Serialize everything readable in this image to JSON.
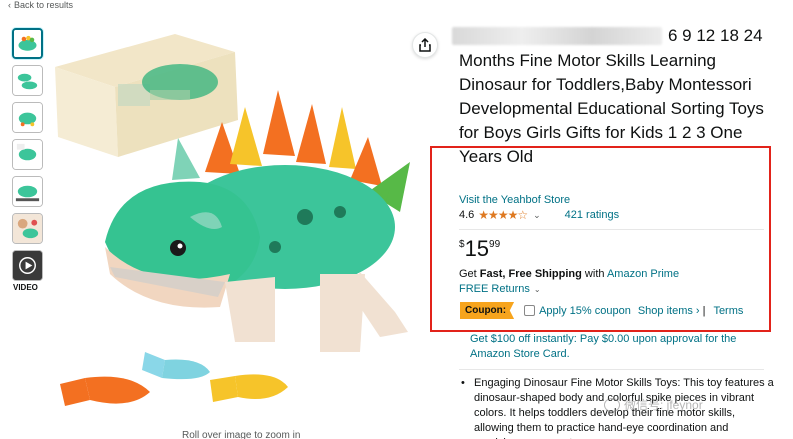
{
  "nav": {
    "back_label": "Back to results"
  },
  "gallery": {
    "video_label": "VIDEO",
    "rollover_hint": "Roll over image to zoom in",
    "main_image_icon": "green-dinosaur-toy-image",
    "blurred_box_icon": "blurred-product-box"
  },
  "product": {
    "title_top_visible": "6 9 12 18 24",
    "title": "Months Fine Motor Skills Learning Dinosaur for Toddlers,Baby Montessori Developmental Educational Sorting Toys for Boys Girls Gifts for Kids 1 2 3 One Years Old",
    "store_link": "Visit the Yeahbof Store",
    "rating_value": "4.6",
    "rating_stars": "★★★★☆",
    "rating_chevron": "⌄",
    "rating_count": "421 ratings",
    "price_symbol": "$",
    "price_whole": "15",
    "price_fraction": "99",
    "shipping_prefix": "Get ",
    "shipping_bold": "Fast, Free Shipping",
    "shipping_mid": " with ",
    "shipping_prime": "Amazon Prime",
    "returns_label": "FREE Returns",
    "returns_chevron": "⌄"
  },
  "coupon": {
    "badge": "Coupon:",
    "apply_text": "Apply 15% coupon",
    "shop_items": "Shop items ›",
    "separator": "|",
    "terms": "Terms"
  },
  "promo": {
    "text": "Get $100 off instantly: Pay $0.00 upon approval for the Amazon Store Card."
  },
  "bullets": {
    "item_1": "Engaging Dinosaur Fine Motor Skills Toys: This toy features a dinosaur-shaped body and colorful spike pieces in vibrant colors. It helps toddlers develop their fine motor skills, allowing them to practice hand-eye coordination and precision movements."
  },
  "watermark": {
    "text": "微信号: jfeynor"
  },
  "colors": {
    "link": "#007185",
    "star": "#de7921",
    "coupon_badge": "#f7a41d",
    "highlight_border": "#e2231a",
    "dino_green": "#3cc59a"
  }
}
